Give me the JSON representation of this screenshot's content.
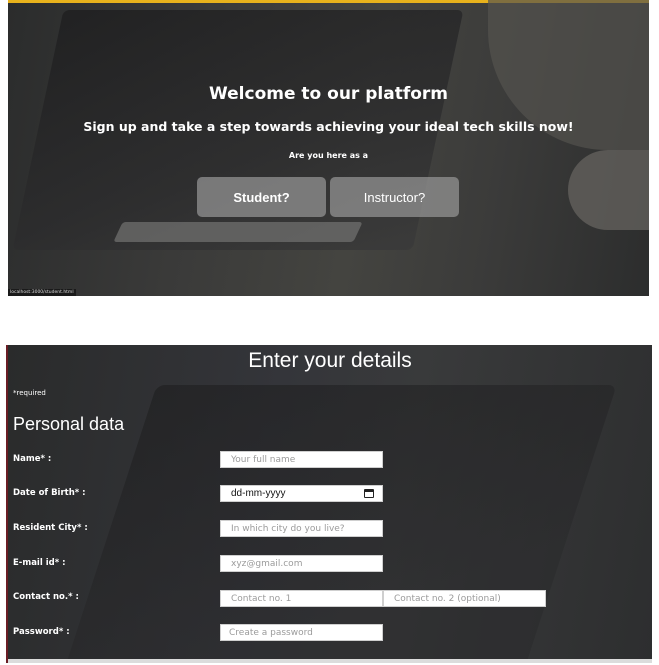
{
  "welcome": {
    "title": "Welcome to our platform",
    "subtitle": "Sign up and take a step towards achieving your ideal tech skills now!",
    "question": "Are you here as a",
    "student_button": "Student?",
    "instructor_button": "Instructor?",
    "status_url": "localhost:3000/student.html"
  },
  "form": {
    "title": "Enter your details",
    "required_note": "*required",
    "section_title": "Personal data",
    "fields": {
      "name": {
        "label": "Name* :",
        "placeholder": "Your full name"
      },
      "dob": {
        "label": "Date of Birth* :",
        "value": "dd-mm-yyyy"
      },
      "city": {
        "label": "Resident City* :",
        "placeholder": "In which city do you live?"
      },
      "email": {
        "label": "E-mail id* :",
        "placeholder": "xyz@gmail.com"
      },
      "contact": {
        "label": "Contact no.* :",
        "placeholder_1": "Contact no. 1",
        "placeholder_2": "Contact no. 2 (optional)"
      },
      "password": {
        "label": "Password* :",
        "placeholder": "Create a password"
      }
    }
  },
  "colors": {
    "accent_top": "#e8b21c",
    "button_bg": "#969696"
  },
  "icons": {
    "date_picker": "calendar-icon"
  }
}
